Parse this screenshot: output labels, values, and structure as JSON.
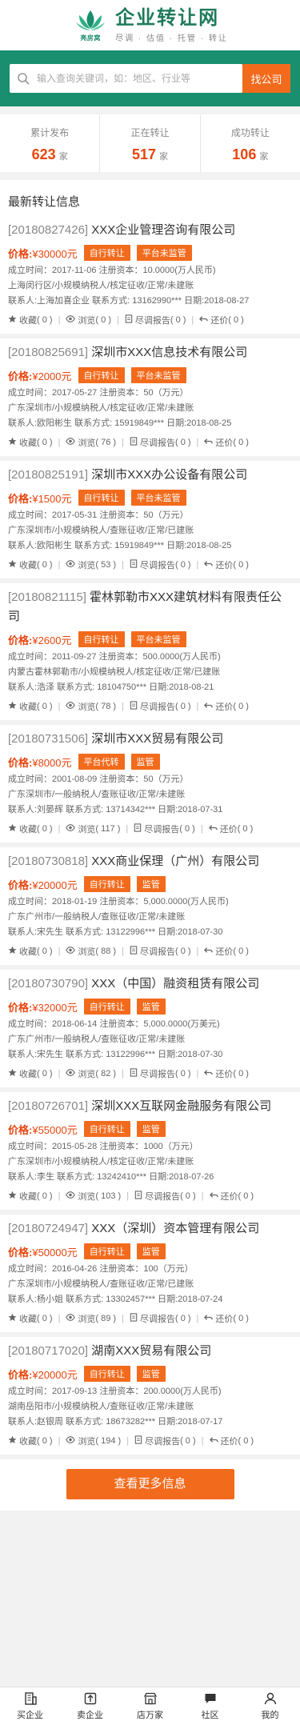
{
  "header": {
    "logo_sub": "亮房窝",
    "title": "企业转让网",
    "slogan": "尽调 · 估值 · 托管 · 转让"
  },
  "search": {
    "placeholder": "输入查询关键词，如：地区、行业等",
    "button": "找公司"
  },
  "stats": [
    {
      "label": "累计发布",
      "value": "623",
      "unit": "家"
    },
    {
      "label": "正在转让",
      "value": "517",
      "unit": "家"
    },
    {
      "label": "成功转让",
      "value": "106",
      "unit": "家"
    }
  ],
  "section_title": "最新转让信息",
  "list_labels": {
    "price": "价格:",
    "collect": "收藏",
    "view": "浏览",
    "report": "尽调报告",
    "bargain": "还价"
  },
  "items": [
    {
      "code": "[20180827426]",
      "name": "XXX企业管理咨询有限公司",
      "price": "¥30000元",
      "tags": [
        "自行转让",
        "平台未监管"
      ],
      "line1": "成立时间：2017-11-06  注册资本：10.0000(万人民币)",
      "line2": "上海闵行区/小规模纳税人/核定征收/正常/未建账",
      "line3": "联系人:上海加喜企业  联系方式: 13162990***  日期:2018-08-27",
      "collect": "( 0 )",
      "view": "( 0 )",
      "report": "( 0 )",
      "bargain": "( 0 )"
    },
    {
      "code": "[20180825691]",
      "name": "深圳市XXX信息技术有限公司",
      "price": "¥2000元",
      "tags": [
        "自行转让",
        "平台未监管"
      ],
      "line1": "成立时间：2017-05-27  注册资本：50（万元）",
      "line2": "广东深圳市/小规模纳税人/核定征收/正常/未建账",
      "line3": "联系人:欧阳彬生  联系方式: 15919849***  日期:2018-08-25",
      "collect": "( 0 )",
      "view": "( 76 )",
      "report": "( 0 )",
      "bargain": "( 0 )"
    },
    {
      "code": "[20180825191]",
      "name": "深圳市XXX办公设备有限公司",
      "price": "¥1500元",
      "tags": [
        "自行转让",
        "平台未监管"
      ],
      "line1": "成立时间：2017-05-31  注册资本：50（万元）",
      "line2": "广东深圳市/小规模纳税人/查账征收/正常/已建账",
      "line3": "联系人:欧阳彬生  联系方式: 15919849***  日期:2018-08-25",
      "collect": "( 0 )",
      "view": "( 53 )",
      "report": "( 0 )",
      "bargain": "( 0 )"
    },
    {
      "code": "[20180821115]",
      "name": "霍林郭勒市XXX建筑材料有限责任公司",
      "price": "¥2600元",
      "tags": [
        "自行转让",
        "平台未监管"
      ],
      "line1": "成立时间：2011-09-27  注册资本：500.0000(万人民币)",
      "line2": "内蒙古霍林郭勒市/小规模纳税人/核定征收/正常/已建账",
      "line3": "联系人:浩泽  联系方式: 18104750***  日期:2018-08-21",
      "collect": "( 0 )",
      "view": "( 78 )",
      "report": "( 0 )",
      "bargain": "( 0 )"
    },
    {
      "code": "[20180731506]",
      "name": "深圳市XXX贸易有限公司",
      "price": "¥8000元",
      "tags": [
        "平台代转",
        "监管"
      ],
      "line1": "成立时间：2001-08-09  注册资本：50（万元）",
      "line2": "广东深圳市/一般纳税人/查账征收/正常/未建账",
      "line3": "联系人:刘晏辉  联系方式: 13714342***  日期:2018-07-31",
      "collect": "( 0 )",
      "view": "( 117 )",
      "report": "( 0 )",
      "bargain": "( 0 )"
    },
    {
      "code": "[20180730818]",
      "name": "XXX商业保理（广州）有限公司",
      "price": "¥20000元",
      "tags": [
        "自行转让",
        "监管"
      ],
      "line1": "成立时间：2018-01-19  注册资本：5,000.0000(万人民币)",
      "line2": "广东广州市/一般纳税人/查账征收/正常/未建账",
      "line3": "联系人:宋先生  联系方式: 13122996***  日期:2018-07-30",
      "collect": "( 0 )",
      "view": "( 88 )",
      "report": "( 0 )",
      "bargain": "( 0 )"
    },
    {
      "code": "[20180730790]",
      "name": "XXX（中国）融资租赁有限公司",
      "price": "¥32000元",
      "tags": [
        "自行转让",
        "监管"
      ],
      "line1": "成立时间：2018-06-14  注册资本：5,000.0000(万美元)",
      "line2": "广东广州市/一般纳税人/查账征收/正常/未建账",
      "line3": "联系人:宋先生  联系方式: 13122996***  日期:2018-07-30",
      "collect": "( 0 )",
      "view": "( 82 )",
      "report": "( 0 )",
      "bargain": "( 0 )"
    },
    {
      "code": "[20180726701]",
      "name": "深圳XXX互联网金融服务有限公司",
      "price": "¥55000元",
      "tags": [
        "自行转让",
        "监管"
      ],
      "line1": "成立时间：2015-05-28  注册资本：1000（万元）",
      "line2": "广东深圳市/小规模纳税人/核定征收/正常/未建账",
      "line3": "联系人:李生  联系方式: 13242410***  日期:2018-07-26",
      "collect": "( 0 )",
      "view": "( 103 )",
      "report": "( 0 )",
      "bargain": "( 0 )"
    },
    {
      "code": "[20180724947]",
      "name": "XXX（深圳）资本管理有限公司",
      "price": "¥50000元",
      "tags": [
        "自行转让",
        "监管"
      ],
      "line1": "成立时间：2016-04-26  注册资本：100（万元）",
      "line2": "广东深圳市/小规模纳税人/查账征收/正常/已建账",
      "line3": "联系人:杨小姐  联系方式: 13302457***  日期:2018-07-24",
      "collect": "( 0 )",
      "view": "( 89 )",
      "report": "( 0 )",
      "bargain": "( 0 )"
    },
    {
      "code": "[20180717020]",
      "name": "湖南XXX贸易有限公司",
      "price": "¥20000元",
      "tags": [
        "自行转让",
        "监管"
      ],
      "line1": "成立时间：2017-09-13  注册资本：200.0000(万人民币)",
      "line2": "湖南岳阳市/小规模纳税人/查账征收/正常/未建账",
      "line3": "联系人:赵银周  联系方式: 18673282***  日期:2018-07-17",
      "collect": "( 0 )",
      "view": "( 194 )",
      "report": "( 0 )",
      "bargain": "( 0 )"
    }
  ],
  "more_button": "查看更多信息",
  "nav": [
    {
      "label": "买企业",
      "icon": "building-icon"
    },
    {
      "label": "卖企业",
      "icon": "upload-icon"
    },
    {
      "label": "店万家",
      "icon": "shop-icon"
    },
    {
      "label": "社区",
      "icon": "chat-icon"
    },
    {
      "label": "我的",
      "icon": "user-icon"
    }
  ],
  "colors": {
    "brand_green": "#1a8f6f",
    "accent_orange": "#f26b1d",
    "price_red": "#e8450e"
  }
}
